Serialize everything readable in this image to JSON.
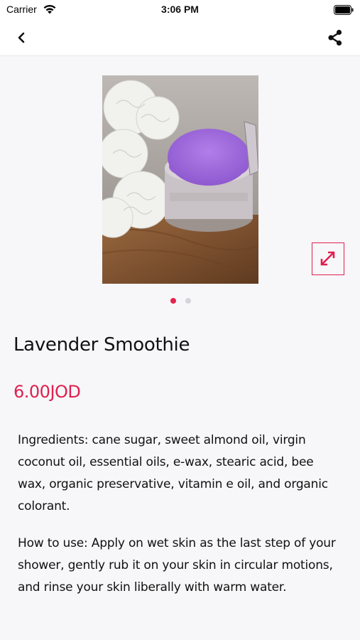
{
  "status_bar": {
    "carrier": "Carrier",
    "time": "3:06 PM"
  },
  "nav": {
    "back_icon": "chevron-left-icon",
    "share_icon": "share-icon"
  },
  "gallery": {
    "image_description": "photo-of-jar",
    "total_images": 2,
    "active_index": 0,
    "expand_icon": "expand-arrows-icon"
  },
  "product": {
    "name": "Lavender Smoothie",
    "price": "6.00JOD",
    "ingredients": "Ingredients: cane sugar, sweet almond oil, virgin coconut oil, essential oils, e-wax, stearic acid, bee wax, organic preservative, vitamin e oil, and organic colorant.",
    "how_to_use": "How to use: Apply on wet skin as the last step of your shower, gently rub it on your skin in circular motions, and rinse your skin liberally with warm water."
  },
  "colors": {
    "accent": "#e0204f",
    "background": "#f7f7f9"
  }
}
